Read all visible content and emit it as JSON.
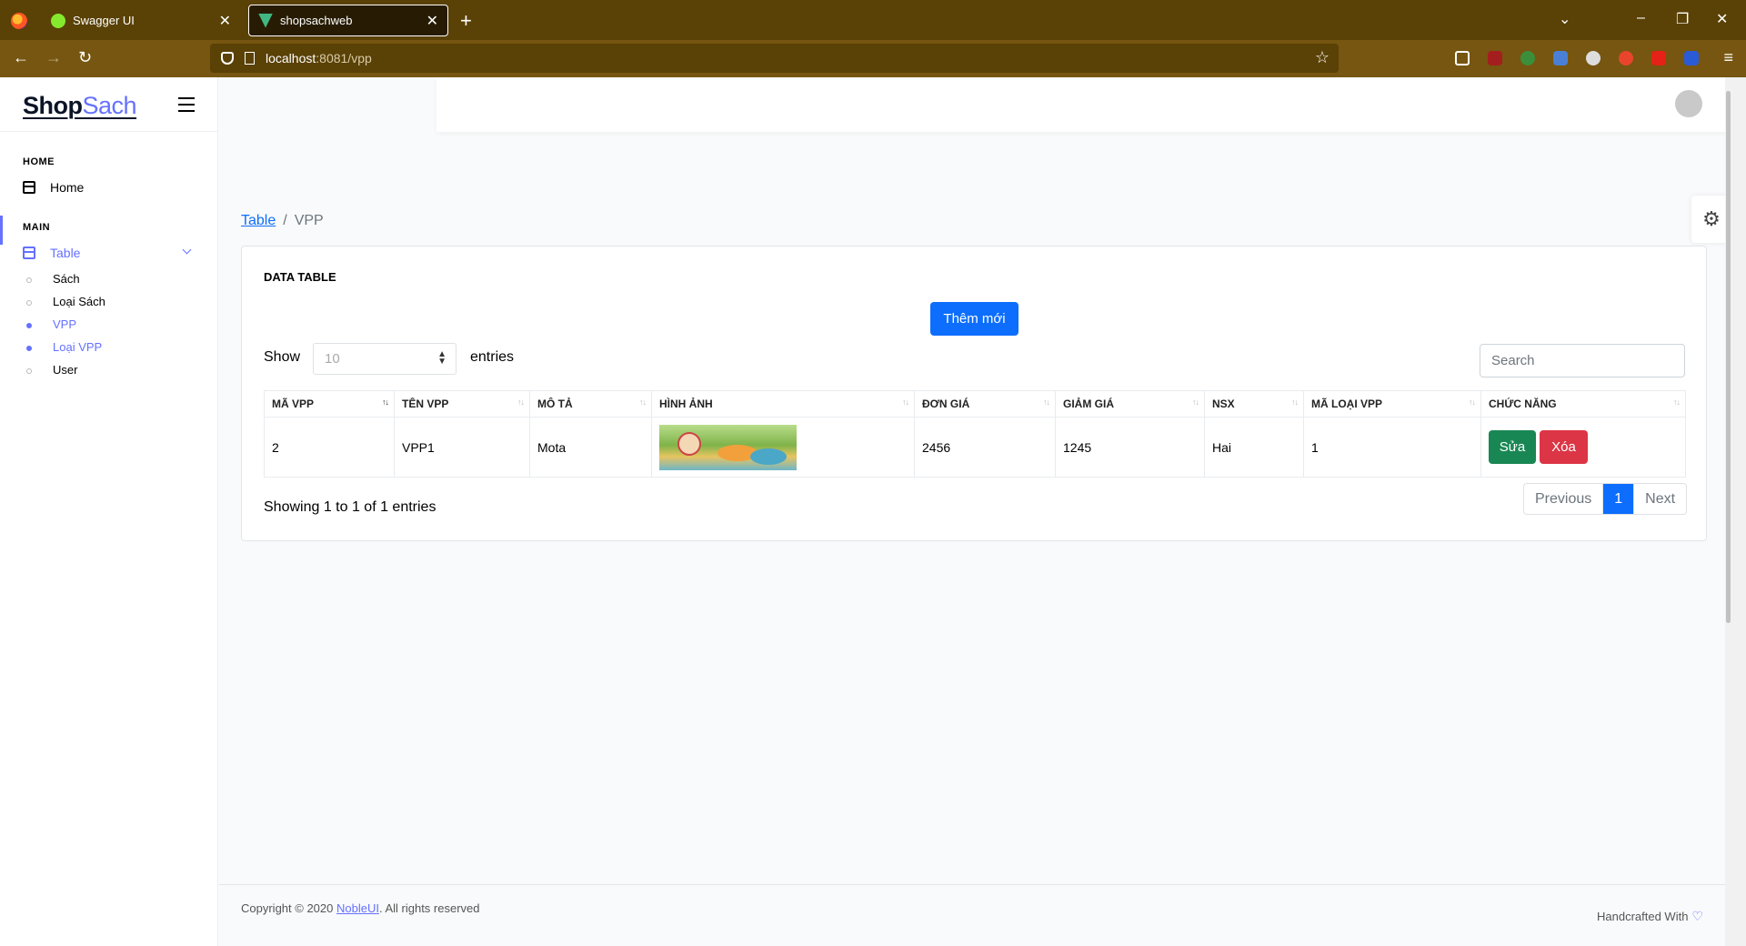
{
  "browser": {
    "tabs": [
      {
        "label": "Swagger UI",
        "favicon_color": "#85ea2d"
      },
      {
        "label": "shopsachweb",
        "favicon_color": "#41b883"
      }
    ],
    "url_host": "localhost",
    "url_rest": ":8081/vpp"
  },
  "sidebar": {
    "logo_bold": "Shop",
    "logo_light": "Sach",
    "cat_home": "HOME",
    "home": "Home",
    "cat_main": "MAIN",
    "table": "Table",
    "sub": [
      "Sách",
      "Loại Sách",
      "VPP",
      "Loại VPP",
      "User"
    ]
  },
  "breadcrumb": {
    "link": "Table",
    "current": "VPP"
  },
  "card": {
    "title": "DATA TABLE",
    "add_label": "Thêm mới",
    "show_label": "Show",
    "page_size": "10",
    "entries_label": "entries",
    "search_placeholder": "Search",
    "columns": [
      "MÃ VPP",
      "TÊN VPP",
      "MÔ TẢ",
      "HÌNH ẢNH",
      "ĐƠN GIÁ",
      "GIẢM GIÁ",
      "NSX",
      "MÃ LOẠI VPP",
      "CHỨC NĂNG"
    ],
    "rows": [
      {
        "ma": "2",
        "ten": "VPP1",
        "mota": "Mota",
        "dongia": "2456",
        "giamgia": "1245",
        "nsx": "Hai",
        "maloai": "1"
      }
    ],
    "edit_label": "Sửa",
    "delete_label": "Xóa",
    "info": "Showing 1 to 1 of 1 entries",
    "prev": "Previous",
    "page": "1",
    "next": "Next"
  },
  "footer": {
    "copy_prefix": "Copyright © 2020 ",
    "brand": "NobleUI",
    "copy_suffix": ". All rights reserved",
    "handcrafted": "Handcrafted With"
  },
  "colors": {
    "primary": "#6571ff",
    "button_blue": "#0d6efd",
    "edit": "#198754",
    "delete": "#dc3545",
    "chrome": "#5a4106"
  },
  "icons": [
    "firefox-icon",
    "shield-icon",
    "page-icon",
    "star-icon",
    "gear-icon",
    "heart-icon",
    "menu-icon"
  ]
}
